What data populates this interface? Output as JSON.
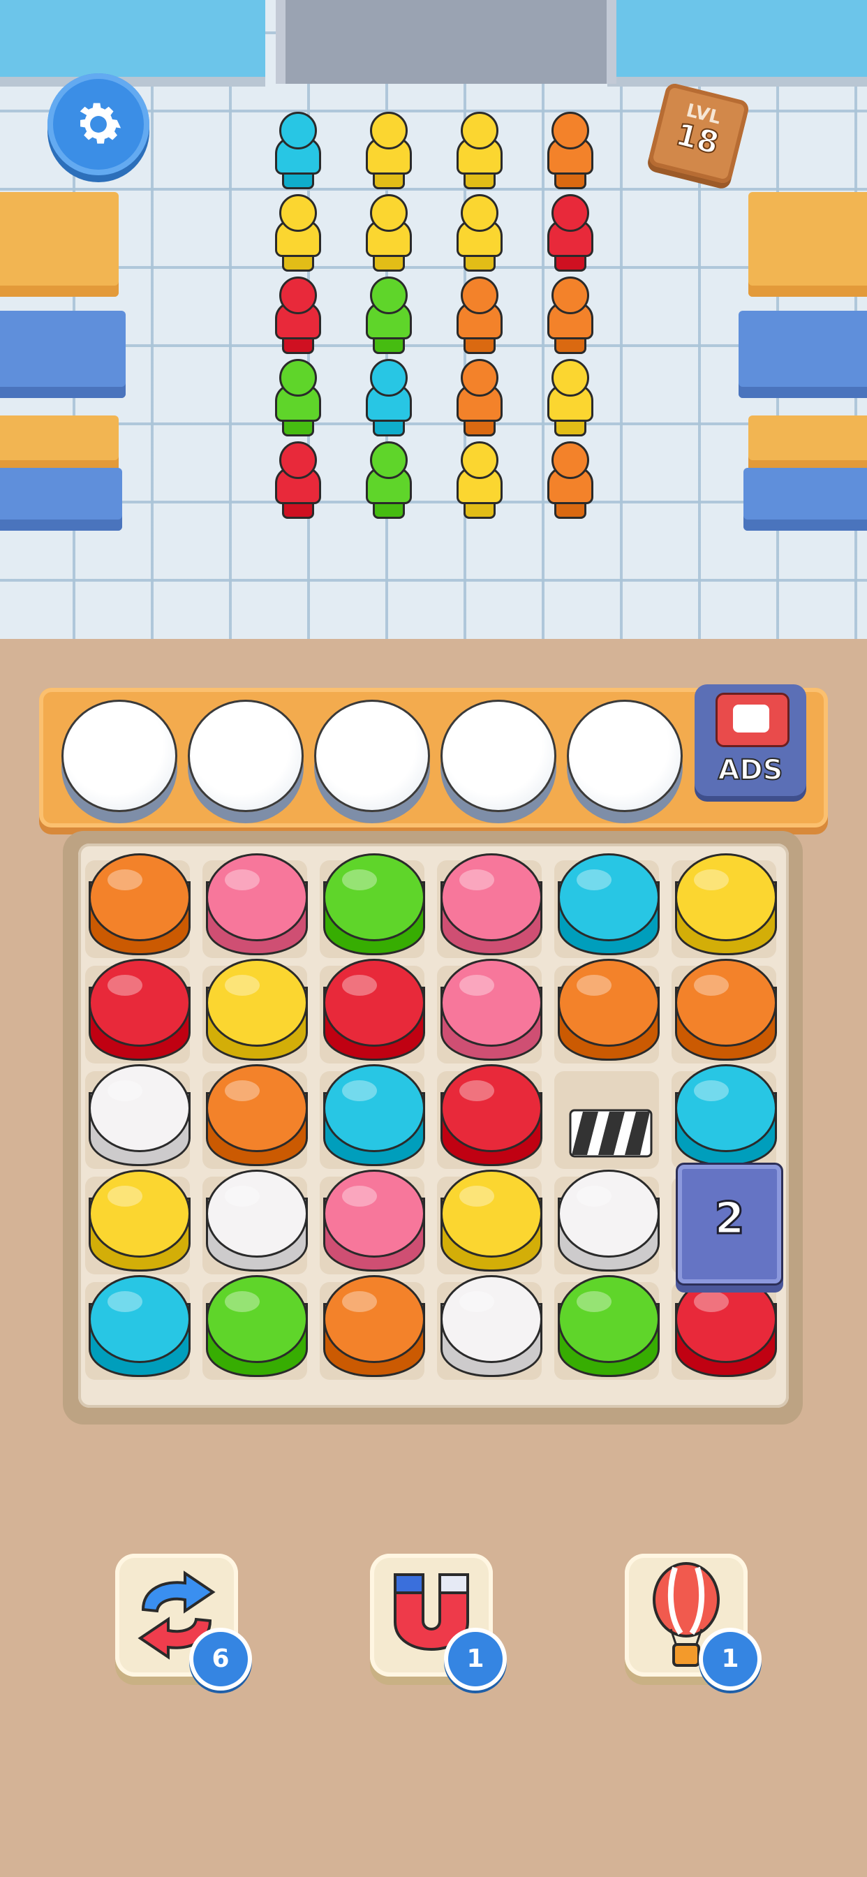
{
  "level": {
    "prefix": "LVL",
    "number": "18"
  },
  "ads_label": "ADS",
  "locked_crate_count": "2",
  "queue": [
    [
      "cyan",
      "yellow",
      "red",
      "green",
      "red"
    ],
    [
      "yellow",
      "yellow",
      "green",
      "cyan",
      "green"
    ],
    [
      "yellow",
      "yellow",
      "orange",
      "orange",
      "yellow"
    ],
    [
      "orange",
      "red",
      "orange",
      "yellow",
      "orange"
    ]
  ],
  "empty_slots": 5,
  "board": [
    [
      "orange",
      "pink",
      "green",
      "pink",
      "cyan",
      "yellow"
    ],
    [
      "red",
      "yellow",
      "red",
      "pink",
      "orange",
      "orange"
    ],
    [
      "white",
      "orange",
      "cyan",
      "red",
      "clapper",
      "cyan"
    ],
    [
      "yellow",
      "white",
      "pink",
      "yellow",
      "white",
      "crate"
    ],
    [
      "cyan",
      "green",
      "orange",
      "white",
      "green",
      "red"
    ]
  ],
  "powerups": [
    {
      "name": "shuffle",
      "count": "6"
    },
    {
      "name": "magnet",
      "count": "1"
    },
    {
      "name": "balloon",
      "count": "1"
    }
  ],
  "colors": {
    "cyan": "#28c6e4",
    "yellow": "#fbd630",
    "red": "#e8293a",
    "green": "#5fd52a",
    "orange": "#f3822a",
    "pink": "#f7779b",
    "white": "#f5f3f4"
  }
}
